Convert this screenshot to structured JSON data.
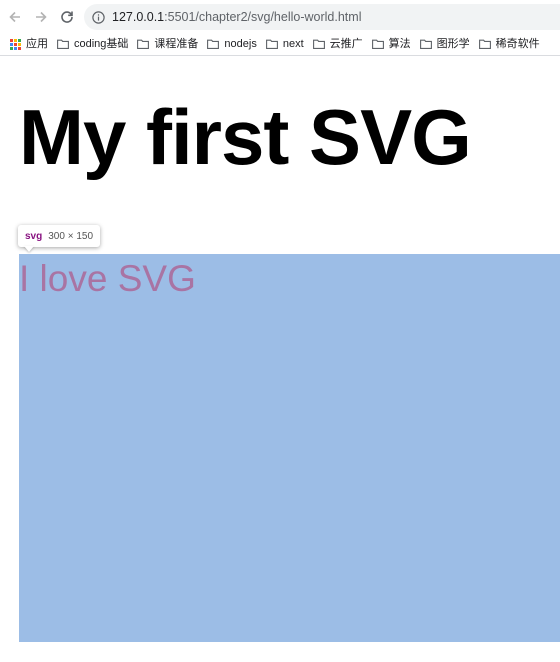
{
  "browser": {
    "url": "127.0.0.1:5501/chapter2/svg/hello-world.html",
    "url_host": "127.0.0.1",
    "url_rest": ":5501/chapter2/svg/hello-world.html",
    "bookmarks": [
      {
        "label": "应用",
        "icon": "apps-grid-icon"
      },
      {
        "label": "coding基础",
        "icon": "folder-icon"
      },
      {
        "label": "课程准备",
        "icon": "folder-icon"
      },
      {
        "label": "nodejs",
        "icon": "folder-icon"
      },
      {
        "label": "next",
        "icon": "folder-icon"
      },
      {
        "label": "云推广",
        "icon": "folder-icon"
      },
      {
        "label": "算法",
        "icon": "folder-icon"
      },
      {
        "label": "图形学",
        "icon": "folder-icon"
      },
      {
        "label": "稀奇软件",
        "icon": "folder-icon"
      }
    ]
  },
  "page": {
    "heading": "My first SVG",
    "svg_text": "I love SVG",
    "svg_text_color": "#a974a3",
    "svg_background": "#9cbde6"
  },
  "devtools_tooltip": {
    "tag": "svg",
    "dimensions": "300 × 150"
  }
}
